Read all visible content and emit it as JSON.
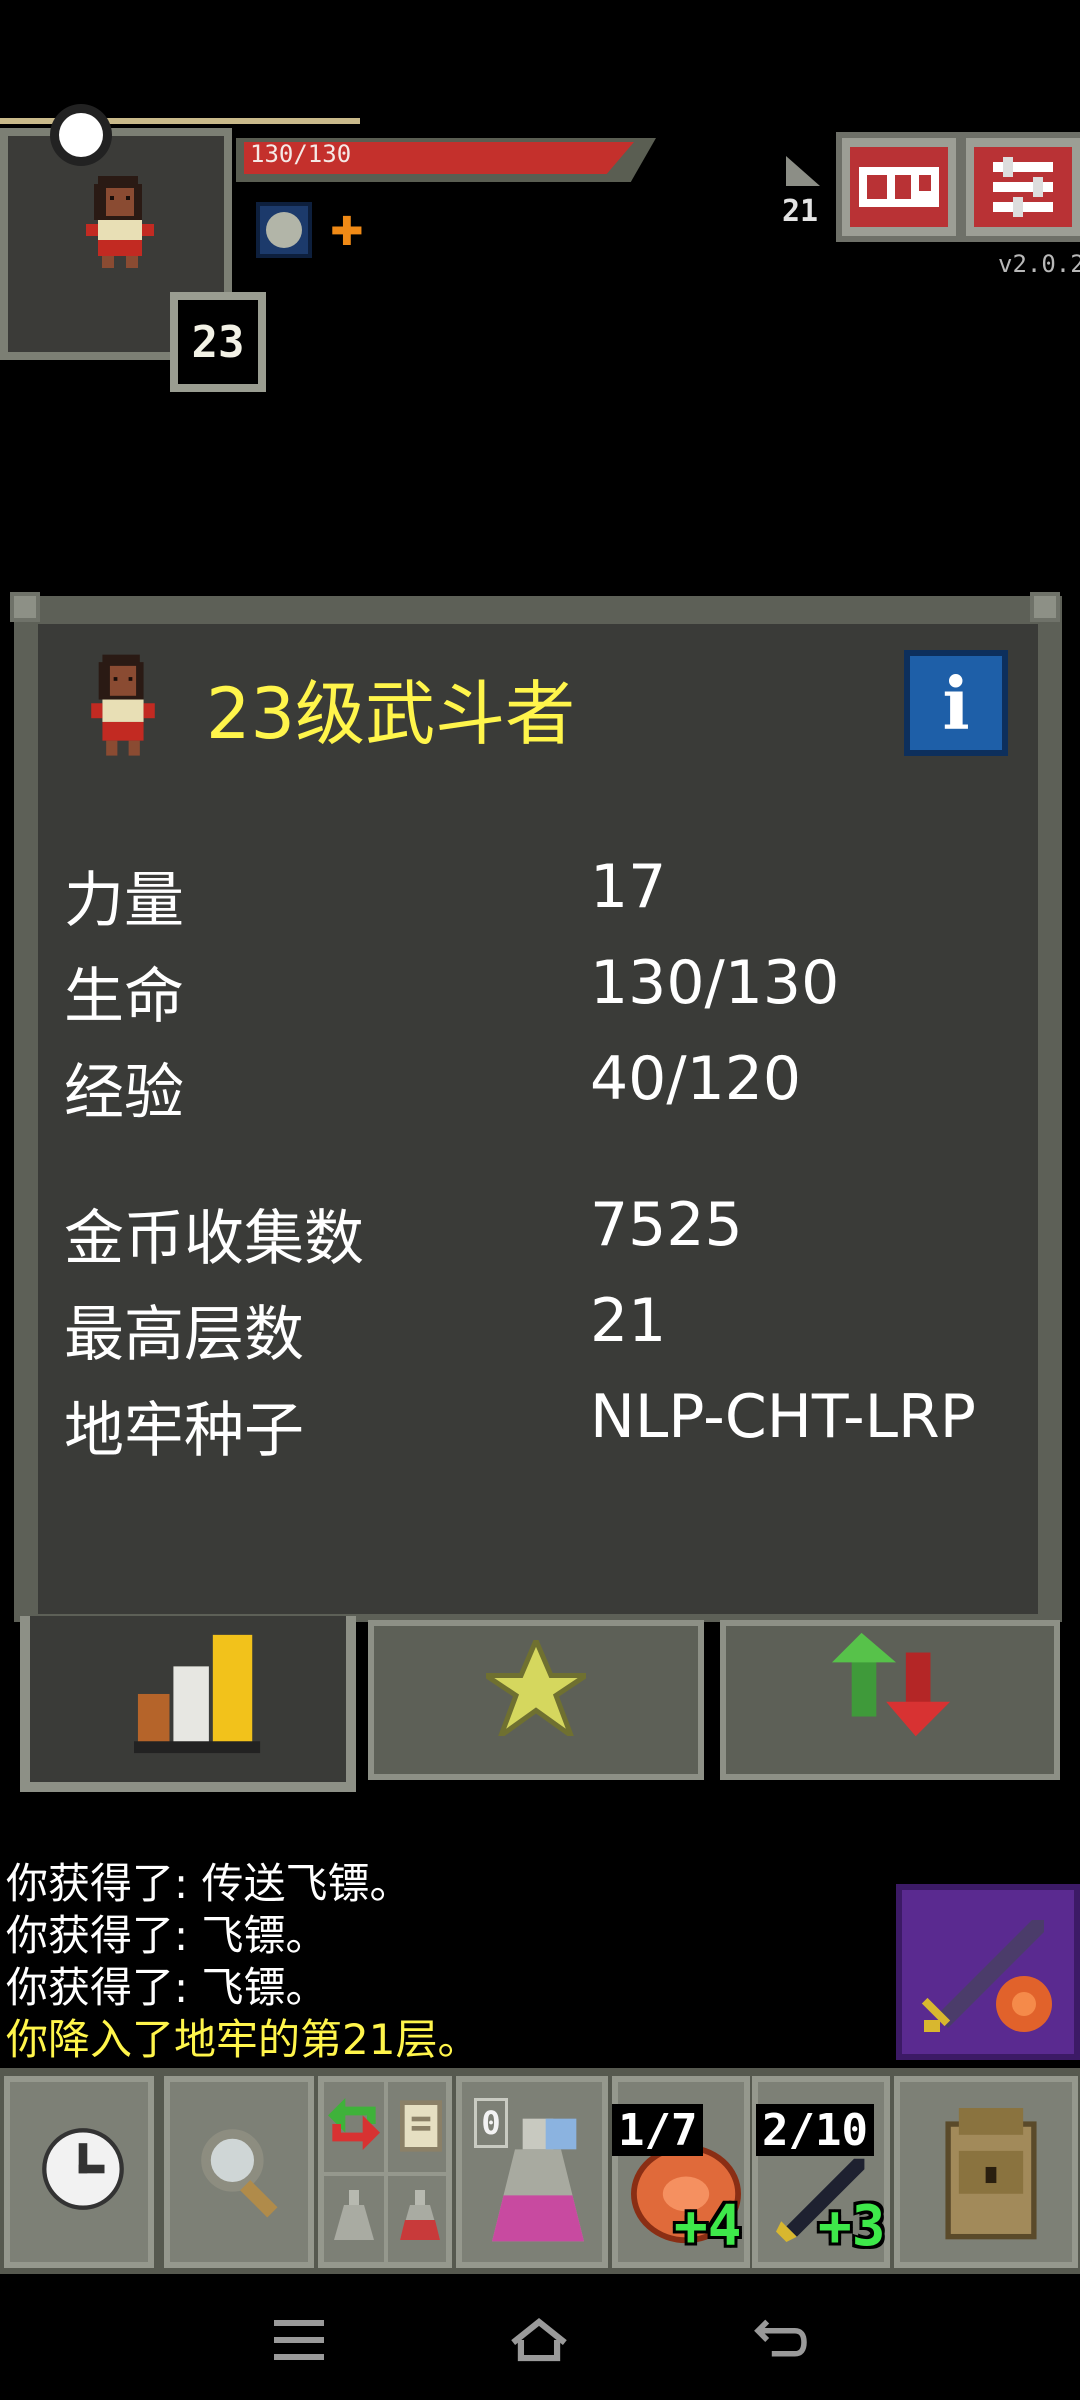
{
  "hud": {
    "hp_text": "130/130",
    "hp_fraction": 1.0,
    "hero_level": "23",
    "depth": "21",
    "version": "v2.0.2",
    "buff_icons": [
      "mind-vision-buff-icon",
      "strength-boost-buff-icon"
    ]
  },
  "stats": {
    "title": "23级武斗者",
    "rows": [
      {
        "label": "力量",
        "value": "17"
      },
      {
        "label": "生命",
        "value": "130/130"
      },
      {
        "label": "经验",
        "value": "40/120"
      },
      {
        "label": "金币收集数",
        "value": "7525"
      },
      {
        "label": "最高层数",
        "value": "21"
      },
      {
        "label": "地牢种子",
        "value": "NLP-CHT-LRP"
      }
    ],
    "tabs": [
      "stats-tab",
      "badges-tab",
      "journal-tab"
    ],
    "active_tab": "stats-tab"
  },
  "log": {
    "lines": [
      {
        "text": "你获得了:  传送飞镖。",
        "color": "#ffffff"
      },
      {
        "text": "你获得了:  飞镖。",
        "color": "#ffffff"
      },
      {
        "text": "你获得了:  飞镖。",
        "color": "#ffffff"
      },
      {
        "text": "你降入了地牢的第21层。",
        "color": "#fff54b"
      }
    ]
  },
  "toolbar": {
    "quickslot_potion_count": "0",
    "quickslot_food_count": "1/7",
    "quickslot_food_bonus": "+4",
    "quickslot_weapon_count": "2/10",
    "quickslot_weapon_bonus": "+3"
  },
  "colors": {
    "title_yellow": "#fff54b",
    "hp_red": "#c4302c",
    "window_bg": "#3a3b38",
    "frame": "#5d6057"
  }
}
